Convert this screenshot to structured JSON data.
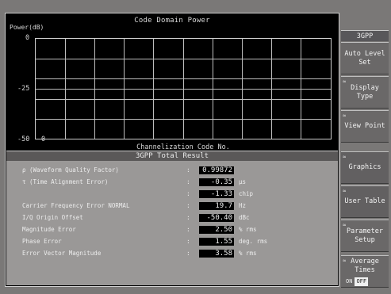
{
  "graph": {
    "title": "Code Domain Power",
    "y_label": "Power(dB)",
    "y_ticks": [
      "0",
      "-25",
      "-50"
    ],
    "x_start": "0",
    "x_label": "Channelization Code No."
  },
  "results": {
    "title": "3GPP Total Result",
    "rows": [
      {
        "label": "ρ (Waveform Quality Factor)",
        "colon": ":",
        "value": "0.99872",
        "unit": ""
      },
      {
        "label": "τ (Time Alignment Error)",
        "colon": ":",
        "value": "-0.35",
        "unit": "μs"
      },
      {
        "label": "",
        "colon": ":",
        "value": "-1.33",
        "unit": "chip"
      },
      {
        "label": "Carrier Frequency Error NORMAL",
        "colon": ":",
        "value": "19.7",
        "unit": "Hz"
      },
      {
        "label": "I/Q Origin Offset",
        "colon": ":",
        "value": "-50.40",
        "unit": "dBc"
      },
      {
        "label": "Magnitude Error",
        "colon": ":",
        "value": "2.50",
        "unit": "% rms"
      },
      {
        "label": "Phase Error",
        "colon": ":",
        "value": "1.55",
        "unit": "deg. rms"
      },
      {
        "label": "Error Vector Magnitude",
        "colon": ":",
        "value": "3.58",
        "unit": "% rms"
      }
    ]
  },
  "softkeys": {
    "header": "3GPP",
    "keys": [
      {
        "mark": "",
        "label": "Auto Level Set"
      },
      {
        "mark": "≈",
        "label": "Display Type"
      },
      {
        "mark": "≈",
        "label": "View Point"
      },
      {
        "mark": "≈",
        "label": "Graphics"
      },
      {
        "mark": "≈",
        "label": "User Table"
      },
      {
        "mark": "≈",
        "label": "Parameter Setup"
      },
      {
        "mark": "≈",
        "label": "Average Times"
      }
    ],
    "toggle_on": "ON",
    "toggle_off": "OFF"
  }
}
